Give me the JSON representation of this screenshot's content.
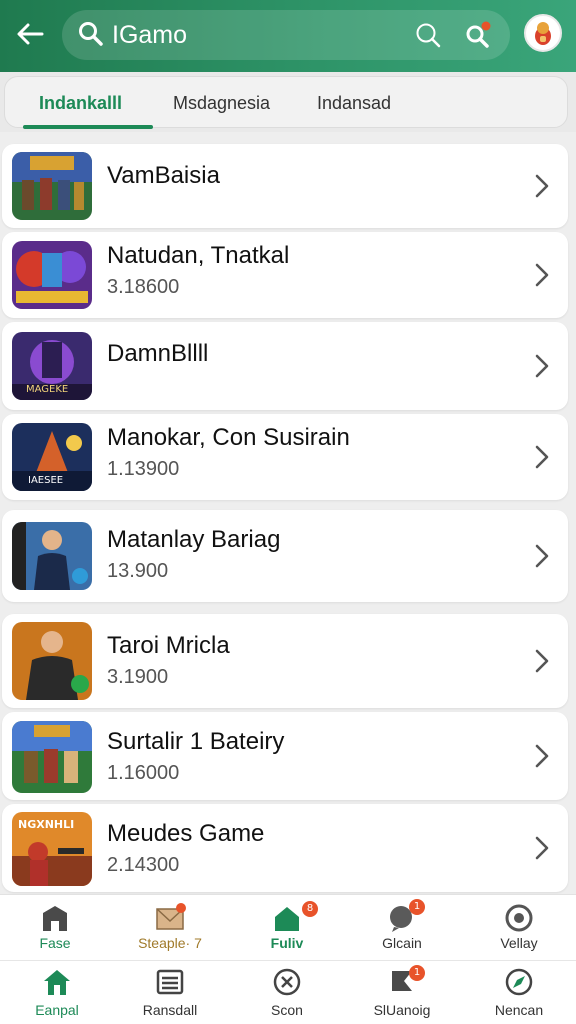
{
  "header": {
    "search_text": "IGamo",
    "back_icon": "arrow-left-icon",
    "search_icon": "search-icon",
    "colors": {
      "header_start": "#1f7a4f",
      "header_end": "#3aa57a",
      "accent": "#1d8a57"
    }
  },
  "tabs": [
    {
      "label": "Indankalll",
      "active": true
    },
    {
      "label": "Msdagnesia",
      "active": false
    },
    {
      "label": "Indansad",
      "active": false
    }
  ],
  "items": [
    {
      "title": "VamBaisia",
      "subtitle": ""
    },
    {
      "title": "Natudan, Tnatkal",
      "subtitle": "3.18600"
    },
    {
      "title": "DamnBllll",
      "subtitle": ""
    },
    {
      "title": "Manokar, Con Susirain",
      "subtitle": "1.13900"
    },
    {
      "title": "Matanlay Bariag",
      "subtitle": "13.900"
    },
    {
      "title": "Taroi Mricla",
      "subtitle": "3.1900"
    },
    {
      "title": "Surtalir 1 Bateiry",
      "subtitle": "1.16000"
    },
    {
      "title": "Meudes Game",
      "subtitle": "2.14300"
    }
  ],
  "thumb_text": {
    "t0": "",
    "t1": "",
    "t2": "MAGEKE",
    "t3": "IAESEE",
    "t4": "",
    "t5": "",
    "t6": "",
    "t7": "NGXNHLI"
  },
  "nav_top": [
    {
      "label": "Fase",
      "icon": "castle-icon"
    },
    {
      "label": "Steaple· 7",
      "icon": "mail-icon"
    },
    {
      "label": "Fuliv",
      "icon": "home-badge-icon",
      "badge": "8"
    },
    {
      "label": "Glcain",
      "icon": "chat-icon",
      "badge": "1"
    },
    {
      "label": "Vellay",
      "icon": "target-icon"
    }
  ],
  "nav_bottom": [
    {
      "label": "Eanpal",
      "icon": "home-icon",
      "active": true
    },
    {
      "label": "Ransdall",
      "icon": "list-icon"
    },
    {
      "label": "Scon",
      "icon": "x-circle-icon"
    },
    {
      "label": "SlUanoig",
      "icon": "flag-icon",
      "badge": "1"
    },
    {
      "label": "Nencan",
      "icon": "compass-icon"
    }
  ]
}
